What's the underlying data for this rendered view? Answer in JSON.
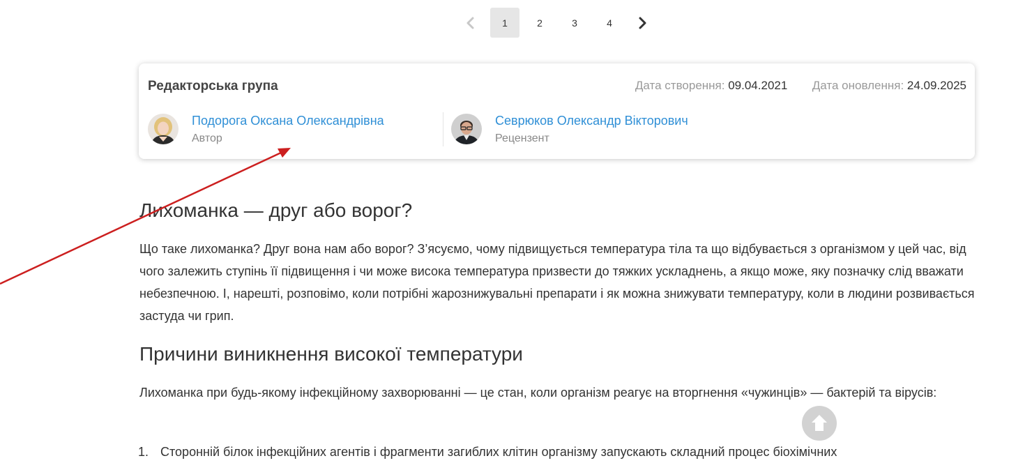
{
  "pagination": {
    "prev_icon": "chevron-left-icon",
    "next_icon": "chevron-right-icon",
    "pages": [
      "1",
      "2",
      "3",
      "4"
    ],
    "active_page": "1"
  },
  "editorial": {
    "title": "Редакторська група",
    "created_label": "Дата створення:",
    "created_value": "09.04.2021",
    "updated_label": "Дата оновлення:",
    "updated_value": "24.09.2025",
    "people": [
      {
        "name": "Подорога Оксана Олександрівна",
        "role": "Автор"
      },
      {
        "name": "Севрюков Олександр Вікторович",
        "role": "Рецензент"
      }
    ]
  },
  "article": {
    "heading_1": "Лихоманка — друг або ворог?",
    "paragraph_1": "Що таке лихоманка? Друг вона нам або ворог? З’ясуємо, чому підвищується температура тіла та що відбувається з організмом у цей час, від чого залежить ступінь її підвищення і чи може висока температура призвести до тяжких ускладнень, а якщо може, яку позначку слід вважати небезпечною. І, нарешті, розповімо, коли потрібні жарознижувальні препарати і як можна знижувати температуру, коли в людини розвивається застуда чи грип.",
    "heading_2": "Причини виникнення високої температури",
    "paragraph_2": "Лихоманка при будь-якому інфекційному захворюванні — це стан, коли організм реагує на вторгнення «чужинців» — бактерій та вірусів:",
    "list_items": [
      "Сторонній білок інфекційних агентів і фрагменти загиблих клітин організму запускають складний процес біохімічних"
    ]
  },
  "overlay": {
    "annotation_color": "#cc1f1f",
    "back_to_top_icon": "arrow-up-icon"
  }
}
